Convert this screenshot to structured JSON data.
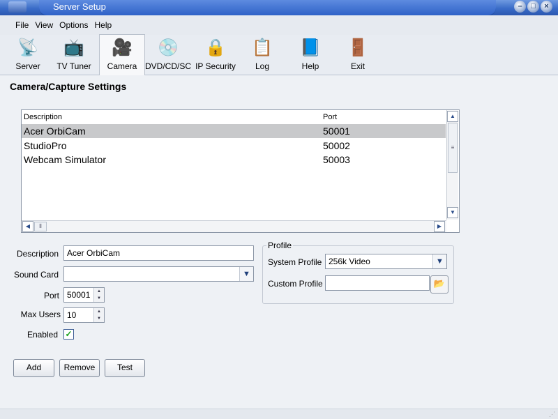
{
  "window": {
    "title": "Server Setup",
    "min": "–",
    "max": "□",
    "close": "×"
  },
  "menu": [
    "File",
    "View",
    "Options",
    "Help"
  ],
  "toolbar": [
    {
      "label": "Server",
      "icon": "satellite-dish-icon",
      "glyph": "📡"
    },
    {
      "label": "TV Tuner",
      "icon": "tv-icon",
      "glyph": "📺"
    },
    {
      "label": "Camera",
      "icon": "camera-icon",
      "glyph": "🎥"
    },
    {
      "label": "DVD/CD/SC",
      "icon": "disc-icon",
      "glyph": "💿"
    },
    {
      "label": "IP Security",
      "icon": "padlock-icon",
      "glyph": "🔒"
    },
    {
      "label": "Log",
      "icon": "log-icon",
      "glyph": "📋"
    },
    {
      "label": "Help",
      "icon": "help-book-icon",
      "glyph": "📘"
    },
    {
      "label": "Exit",
      "icon": "exit-door-icon",
      "glyph": "🚪"
    }
  ],
  "selected_tool": "Camera",
  "heading": "Camera/Capture Settings",
  "list": {
    "columns": [
      "Description",
      "Port"
    ],
    "rows": [
      {
        "description": "Acer OrbiCam",
        "port": "50001",
        "selected": true
      },
      {
        "description": "StudioPro",
        "port": "50002",
        "selected": false
      },
      {
        "description": "Webcam Simulator",
        "port": "50003",
        "selected": false
      }
    ]
  },
  "form": {
    "description_label": "Description",
    "description_value": "Acer OrbiCam",
    "sound_card_label": "Sound Card",
    "sound_card_value": "",
    "port_label": "Port",
    "port_value": "50001",
    "max_users_label": "Max Users",
    "max_users_value": "10",
    "enabled_label": "Enabled",
    "enabled_checked": true
  },
  "profile": {
    "legend": "Profile",
    "system_label": "System Profile",
    "system_value": "256k Video",
    "custom_label": "Custom Profile",
    "custom_value": ""
  },
  "buttons": {
    "add": "Add",
    "remove": "Remove",
    "test": "Test"
  },
  "colors": {
    "title_blue": "#3a6cc8",
    "selection_gray": "#c8c9cb",
    "check_green": "#19a019"
  }
}
